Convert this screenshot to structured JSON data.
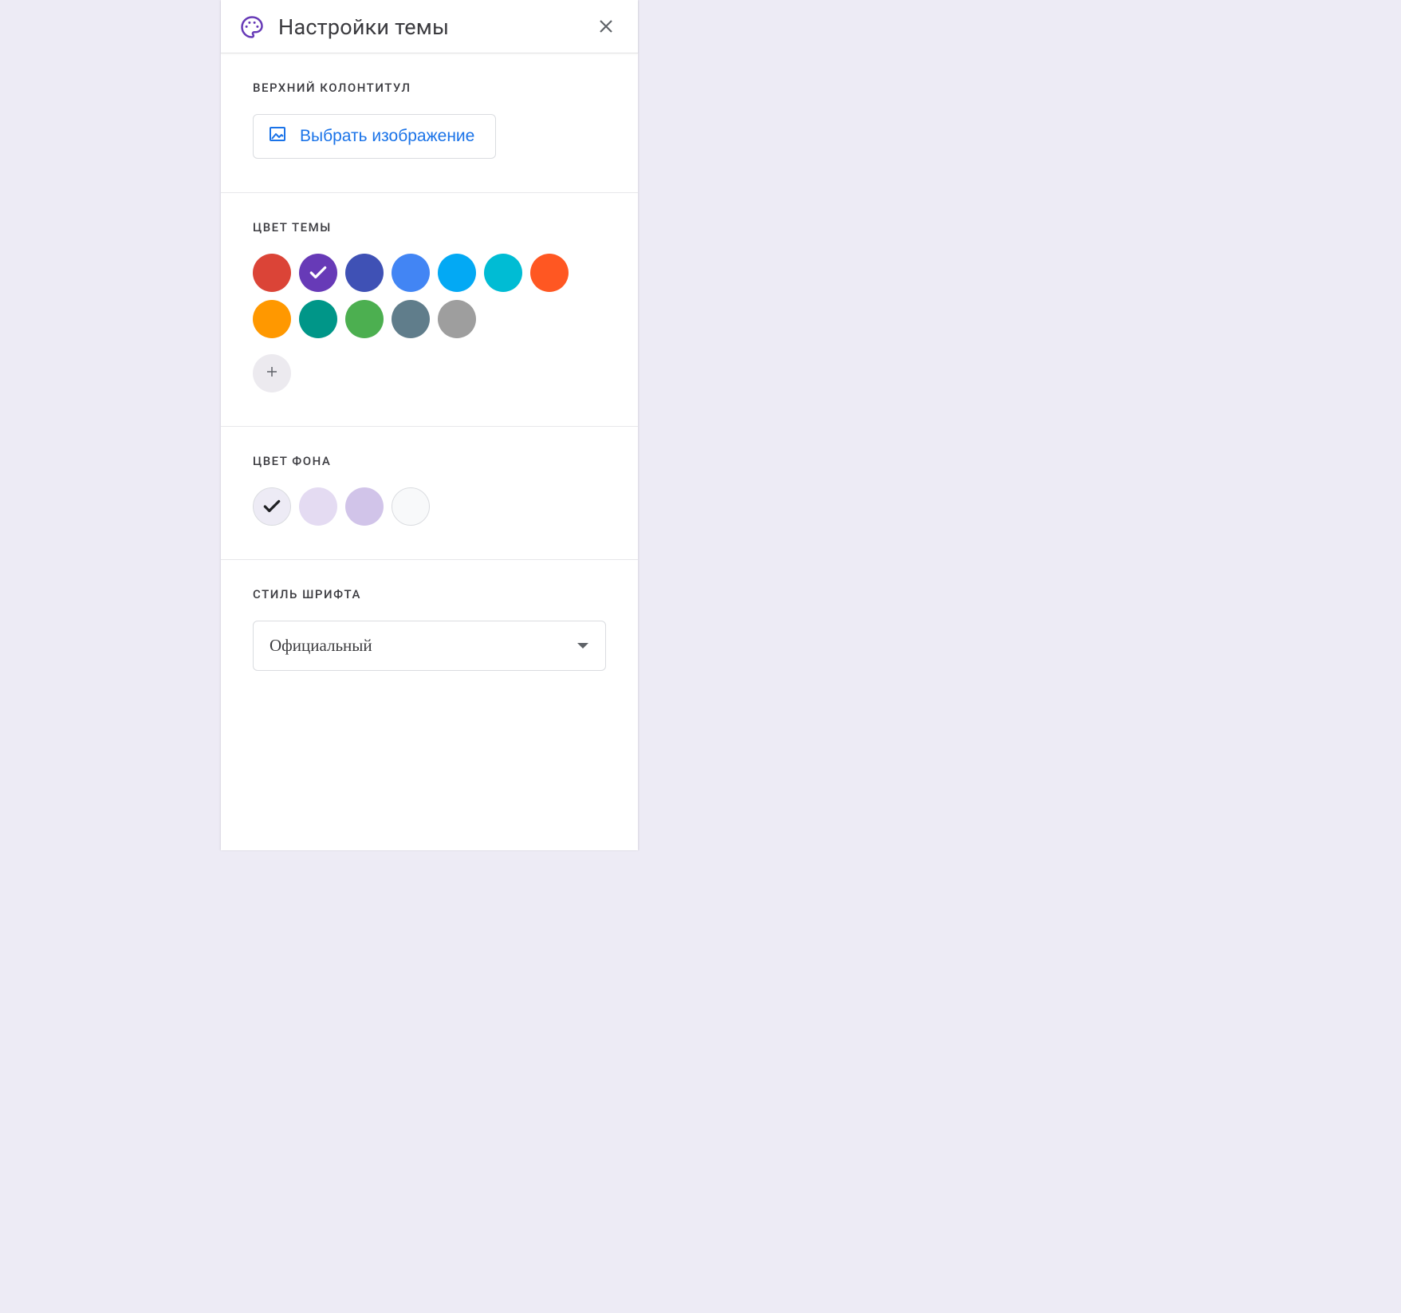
{
  "header": {
    "title": "Настройки темы"
  },
  "sections": {
    "header_image": {
      "label": "ВЕРХНИЙ КОЛОНТИТУЛ",
      "button": "Выбрать изображение"
    },
    "theme_color": {
      "label": "ЦВЕТ ТЕМЫ",
      "colors": [
        {
          "hex": "#db4437",
          "selected": false
        },
        {
          "hex": "#673ab7",
          "selected": true
        },
        {
          "hex": "#3f51b5",
          "selected": false
        },
        {
          "hex": "#4285f4",
          "selected": false
        },
        {
          "hex": "#03a9f4",
          "selected": false
        },
        {
          "hex": "#00bcd4",
          "selected": false
        },
        {
          "hex": "#ff5722",
          "selected": false
        },
        {
          "hex": "#ff9800",
          "selected": false
        },
        {
          "hex": "#009688",
          "selected": false
        },
        {
          "hex": "#4caf50",
          "selected": false
        },
        {
          "hex": "#607d8b",
          "selected": false
        },
        {
          "hex": "#9e9e9e",
          "selected": false
        }
      ]
    },
    "background_color": {
      "label": "ЦВЕТ ФОНА",
      "colors": [
        {
          "hex": "#edebf5",
          "selected": true,
          "outlined": true
        },
        {
          "hex": "#e4dbf2",
          "selected": false,
          "outlined": false
        },
        {
          "hex": "#d1c4e9",
          "selected": false,
          "outlined": false
        },
        {
          "hex": "#f8f9fa",
          "selected": false,
          "outlined": true
        }
      ]
    },
    "font_style": {
      "label": "СТИЛЬ ШРИФТА",
      "selected": "Официальный"
    }
  }
}
